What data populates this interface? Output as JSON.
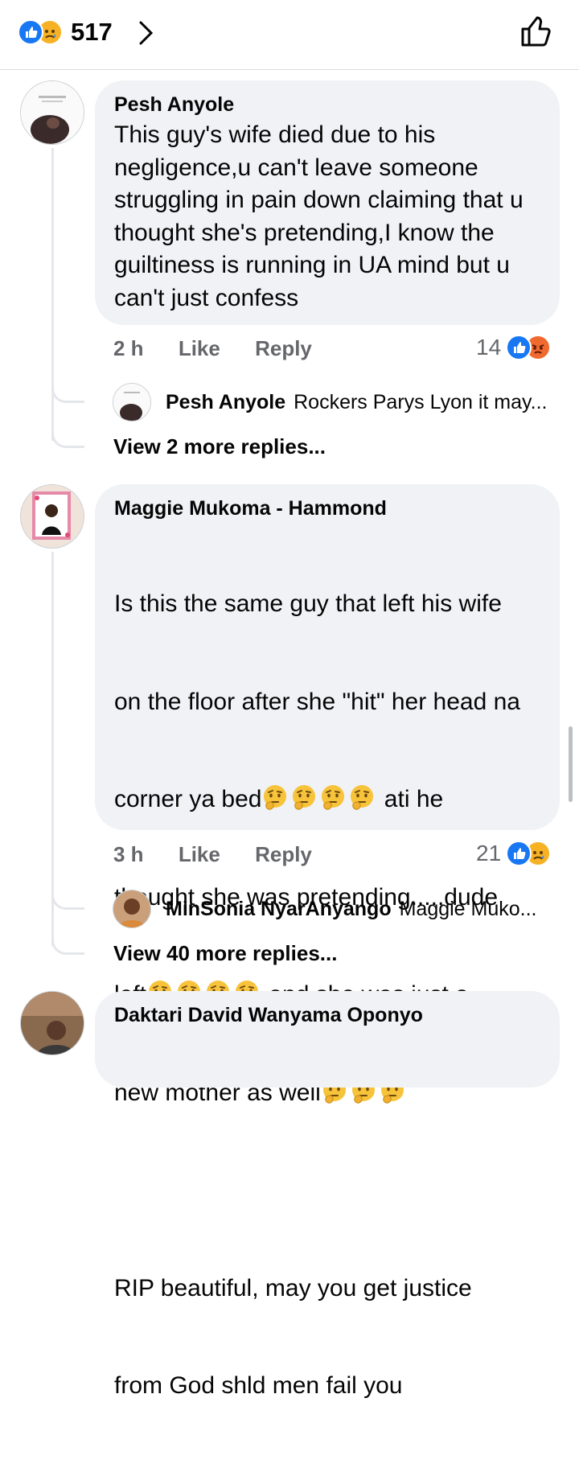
{
  "header": {
    "reaction_icons": [
      "like-icon",
      "sad-face-icon"
    ],
    "count": "517"
  },
  "comments": [
    {
      "author": "Pesh Anyole",
      "text": "This guy's wife died due to his negligence,u can't leave someone struggling in pain down claiming that u thought she's pretending,I know the guiltiness is running in UA mind but u can't just confess",
      "time": "2 h",
      "like_label": "Like",
      "reply_label": "Reply",
      "reaction_count": "14",
      "reaction_icons": [
        "like-icon",
        "angry-face-icon"
      ],
      "reply_preview": {
        "author": "Pesh Anyole",
        "text": "Rockers Parys Lyon it may..."
      },
      "more_replies": "View 2 more replies..."
    },
    {
      "author": "Maggie Mukoma - Hammond",
      "text_lines": [
        "Is this the same guy that left his wife",
        "on the floor after she \"hit\" her head na",
        "corner ya bed",
        "ati he",
        "thought she was pretending.....dude",
        "left",
        "and she was just a",
        "new mother as well",
        "RIP beautiful, may you get justice",
        "from God shld men fail you"
      ],
      "emoji": "thinking-face-icon",
      "time": "3 h",
      "like_label": "Like",
      "reply_label": "Reply",
      "reaction_count": "21",
      "reaction_icons": [
        "like-icon",
        "sad-face-icon"
      ],
      "reply_preview": {
        "author": "MinSonia NyarAnyango",
        "text": "Maggie Muko..."
      },
      "more_replies": "View 40 more replies..."
    },
    {
      "author": "Daktari David Wanyama Oponyo"
    }
  ],
  "colors": {
    "like_blue": "#1877f2",
    "bubble_bg": "#f0f2f5",
    "meta_gray": "#65676b"
  }
}
